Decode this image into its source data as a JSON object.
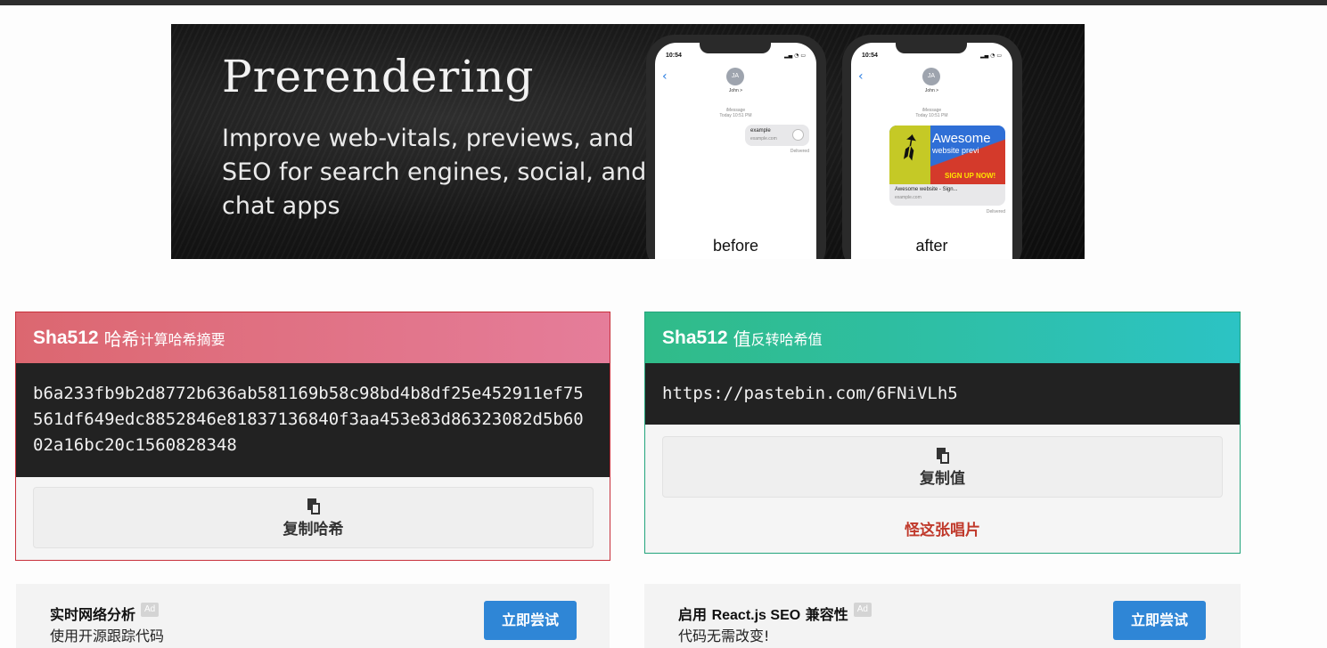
{
  "banner": {
    "title": "Prerendering",
    "subtitle": "Improve web-vitals, previews, and SEO for search engines, social, and chat apps",
    "phones": [
      {
        "time": "10:54",
        "avatar": "JA",
        "contact": "John >",
        "header_line1": "iMessage",
        "header_line2": "Today 10:51 PM",
        "bubble_title": "example",
        "bubble_url": "example.com",
        "delivered": "Delivered",
        "label": "before"
      },
      {
        "time": "10:54",
        "avatar": "JA",
        "contact": "John >",
        "header_line1": "iMessage",
        "header_line2": "Today 10:51 PM",
        "preview_big": "Awesome",
        "preview_small": "website previ",
        "preview_signup": "SIGN UP NOW!",
        "preview_caption": "Awesome website - Sign...",
        "preview_url": "example.com",
        "delivered": "Delivered",
        "label": "after"
      }
    ]
  },
  "hash_card": {
    "title_strong": "Sha512",
    "title_cn": "哈希",
    "title_small": "计算哈希摘要",
    "hash_value": "b6a233fb9b2d8772b636ab581169b58c98bd4b8df25e452911ef75561df649edc8852846e81837136840f3aa453e83d86323082d5b6002a16bc20c1560828348",
    "copy_label": "复制哈希",
    "border_color": "#c7303b"
  },
  "value_card": {
    "title_strong": "Sha512",
    "title_cn": "值",
    "title_small": "反转哈希值",
    "value": "https://pastebin.com/6FNiVLh5",
    "copy_label": "复制值",
    "rip_link": "怪这张唱片",
    "border_color": "#23a47c"
  },
  "ads": [
    {
      "title": "实时网络分析",
      "badge": "Ad",
      "desc": "使用开源跟踪代码",
      "button": "立即尝试"
    },
    {
      "title_prefix": "启用 ",
      "title_latin": "React.js SEO",
      "title_suffix": " 兼容性",
      "badge": "Ad",
      "desc": "代码无需改变!",
      "button": "立即尝试"
    }
  ]
}
